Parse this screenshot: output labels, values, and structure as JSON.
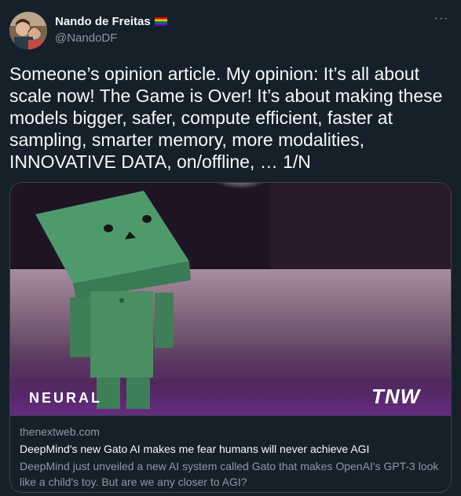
{
  "author": {
    "display_name": "Nando de Freitas",
    "handle": "@NandoDF",
    "flag_icon": "rainbow-flag-icon",
    "flag_colors": [
      "#e40303",
      "#ff8c00",
      "#ffed00",
      "#008026",
      "#004dff",
      "#750787"
    ]
  },
  "more_icon": "···",
  "tweet": {
    "text": "Someone’s opinion article. My opinion: It’s all about\nscale now! The Game is Over! It’s about making these\nmodels bigger, safer, compute efficient, faster at\nsampling, smarter memory, more modalities,\nINNOVATIVE DATA, on/offline, … 1/N"
  },
  "card": {
    "brand_left": "NEURAL",
    "brand_right": "TNW",
    "domain": "thenextweb.com",
    "title": "DeepMind's new Gato AI makes me fear humans will never achieve AGI",
    "description": "DeepMind just unveiled a new AI system called Gato that makes OpenAI's GPT-3 look like a child's toy. But are we any closer to AGI?"
  },
  "colors": {
    "background": "#15202b",
    "text_primary": "#f7f9f9",
    "text_secondary": "#8b98a5",
    "border": "#38444d",
    "robot_green": "#4f9a6c"
  }
}
